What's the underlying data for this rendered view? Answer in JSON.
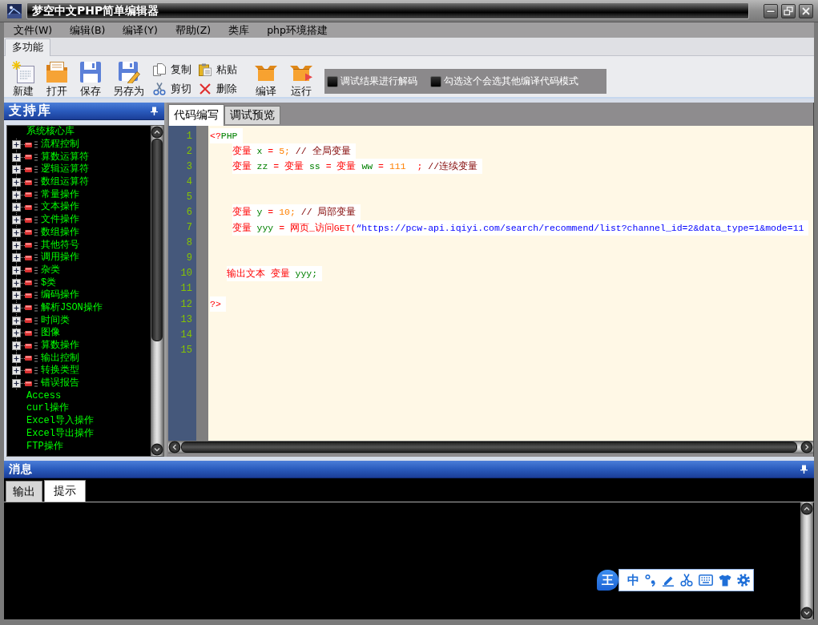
{
  "window": {
    "title": "梦空中文PHP简单编辑器"
  },
  "menu": [
    "文件(W)",
    "编辑(B)",
    "编译(Y)",
    "帮助(Z)",
    "类库",
    "php环境搭建"
  ],
  "ribbon_tabs": [
    {
      "label": "多功能",
      "selected": true
    }
  ],
  "toolbar": {
    "file_buttons": [
      "新建",
      "打开",
      "保存",
      "另存为"
    ],
    "edit_buttons": [
      [
        "复制",
        "剪切"
      ],
      [
        "粘贴",
        "删除"
      ]
    ],
    "build_buttons": [
      "编译",
      "运行"
    ],
    "options": [
      {
        "label": "调试结果进行解码",
        "checked": false
      },
      {
        "label": "勾选这个会选其他编译代码模式",
        "checked": false
      }
    ]
  },
  "library": {
    "title": "支持库",
    "tree": [
      {
        "label": "系统核心库",
        "children": [
          {
            "label": "流程控制",
            "expanded": false
          },
          {
            "label": "算数运算符",
            "expanded": false
          },
          {
            "label": "逻辑运算符",
            "expanded": false
          },
          {
            "label": "数组运算符",
            "expanded": false
          },
          {
            "label": "常量操作",
            "expanded": false
          },
          {
            "label": "文本操作",
            "expanded": false
          },
          {
            "label": "文件操作",
            "expanded": false
          },
          {
            "label": "数组操作",
            "expanded": false
          },
          {
            "label": "其他符号",
            "expanded": false
          },
          {
            "label": "调用操作",
            "expanded": false
          },
          {
            "label": "杂类",
            "expanded": false
          },
          {
            "label": "$类",
            "expanded": false
          },
          {
            "label": "编码操作",
            "expanded": false
          },
          {
            "label": "解析JSON操作",
            "expanded": false
          },
          {
            "label": "时间类",
            "expanded": false
          },
          {
            "label": "图像",
            "expanded": false
          },
          {
            "label": "算数操作",
            "expanded": false
          },
          {
            "label": "输出控制",
            "expanded": false
          },
          {
            "label": "转换类型",
            "expanded": false
          },
          {
            "label": "错误报告",
            "expanded": false
          }
        ]
      },
      {
        "label": "Access"
      },
      {
        "label": "curl操作"
      },
      {
        "label": "Excel导入操作"
      },
      {
        "label": "Excel导出操作"
      },
      {
        "label": "FTP操作"
      }
    ]
  },
  "editor": {
    "tabs": [
      {
        "label": "代码编写",
        "selected": true
      },
      {
        "label": "调试预览",
        "selected": false
      }
    ],
    "lines": [
      {
        "number": "1",
        "tokens": [
          {
            "kind": "operator",
            "text": "<?"
          },
          {
            "kind": "tag",
            "text": "PHP"
          }
        ]
      },
      {
        "number": "2",
        "tokens": [
          {
            "kind": "keyword",
            "text": "    变量 "
          },
          {
            "kind": "variable",
            "text": "x "
          },
          {
            "kind": "operator",
            "text": "= "
          },
          {
            "kind": "number",
            "text": "5;"
          },
          {
            "kind": "comment",
            "text": " // 全局变量"
          }
        ]
      },
      {
        "number": "3",
        "tokens": [
          {
            "kind": "keyword",
            "text": "    变量 "
          },
          {
            "kind": "variable",
            "text": "zz "
          },
          {
            "kind": "operator",
            "text": "= "
          },
          {
            "kind": "keyword",
            "text": "变量 "
          },
          {
            "kind": "variable",
            "text": "ss "
          },
          {
            "kind": "operator",
            "text": "= "
          },
          {
            "kind": "keyword",
            "text": "变量 "
          },
          {
            "kind": "variable",
            "text": "ww "
          },
          {
            "kind": "operator",
            "text": "= "
          },
          {
            "kind": "number",
            "text": "111"
          },
          {
            "kind": "operator",
            "text": "  ;"
          },
          {
            "kind": "comment",
            "text": " //连续变量"
          }
        ]
      },
      {
        "number": "4"
      },
      {
        "number": "5"
      },
      {
        "number": "6",
        "tokens": [
          {
            "kind": "keyword",
            "text": "    变量 "
          },
          {
            "kind": "variable",
            "text": "y "
          },
          {
            "kind": "operator",
            "text": "= "
          },
          {
            "kind": "number",
            "text": "10;"
          },
          {
            "kind": "comment",
            "text": " // 局部变量"
          }
        ]
      },
      {
        "number": "7",
        "tokens": [
          {
            "kind": "keyword",
            "text": "    变量 "
          },
          {
            "kind": "variable",
            "text": "yyy "
          },
          {
            "kind": "operator",
            "text": "= "
          },
          {
            "kind": "keyword",
            "text": "网页_访问GET("
          },
          {
            "kind": "string",
            "text": "“https://pcw-api.iqiyi.com/search/recommend/list?channel_id=2&data_type=1&mode=11"
          }
        ]
      },
      {
        "number": "8"
      },
      {
        "number": "9"
      },
      {
        "number": "10",
        "tokens": [
          {
            "kind": "keyword",
            "text": "   输出文本 变量 "
          },
          {
            "kind": "variable",
            "text": "yyy;"
          }
        ]
      },
      {
        "number": "11"
      },
      {
        "number": "12",
        "tokens": [
          {
            "kind": "operator",
            "text": "?>"
          }
        ]
      },
      {
        "number": "13"
      },
      {
        "number": "14"
      },
      {
        "number": "15"
      }
    ]
  },
  "messages": {
    "title": "消息",
    "tabs": [
      {
        "label": "输出",
        "selected": false
      },
      {
        "label": "提示",
        "selected": true
      }
    ]
  },
  "ime_toolbar": {
    "logo": "王",
    "mode": "中"
  }
}
